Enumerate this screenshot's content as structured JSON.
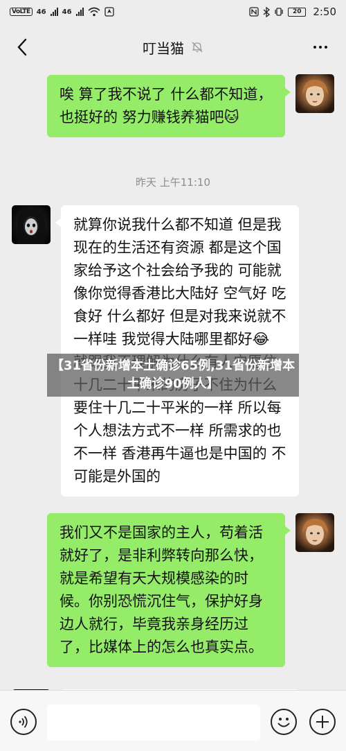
{
  "status_bar": {
    "volte_badge": "VoLTE",
    "signal_1": "46",
    "signal_2": "46",
    "battery": "20",
    "time": "2:50"
  },
  "header": {
    "title": "叮当猫"
  },
  "messages": [
    {
      "side": "out",
      "text": "唉 算了我不说了 什么都不知道，也挺好的 努力赚钱养猫吧",
      "emoji": "🐱"
    },
    {
      "side": "timestamp",
      "text": "昨天 上午11:10"
    },
    {
      "side": "in",
      "text_before": "就算你说我什么都不知道 但是我现在的生活还有资源 都是这个国家给予这个社会给予我的 可能就像你觉得香港比大陆好 空气好 吃食好 什么都好 但是对我来说就不一样哇 我觉得大陆哪里都好",
      "emoji": "😂",
      "text_after": " 就跟我不理解为什么有人宁愿住十几二十平米的房子不住为什么要住十几二十平米的一样 所以每个人想法方式不一样 所需求的也不一样 香港再牛逼也是中国的 不可能是外国的"
    },
    {
      "side": "out",
      "text": "我们又不是国家的主人，苟着活就好了，是非利弊转向那么快，就是希望有天大规模感染的时候。你别恐慌沉住气，保护好身边人就行，毕竟我亲身经历过了，比媒体上的怎么也真实点。"
    }
  ],
  "overlay_caption": "【31省份新增本土确诊65例,31省份新增本土确诊90例人】",
  "input_bar": {
    "placeholder": ""
  },
  "colors": {
    "chat_background": "#ededed",
    "outgoing_bubble": "#95ec69",
    "incoming_bubble": "#ffffff"
  }
}
